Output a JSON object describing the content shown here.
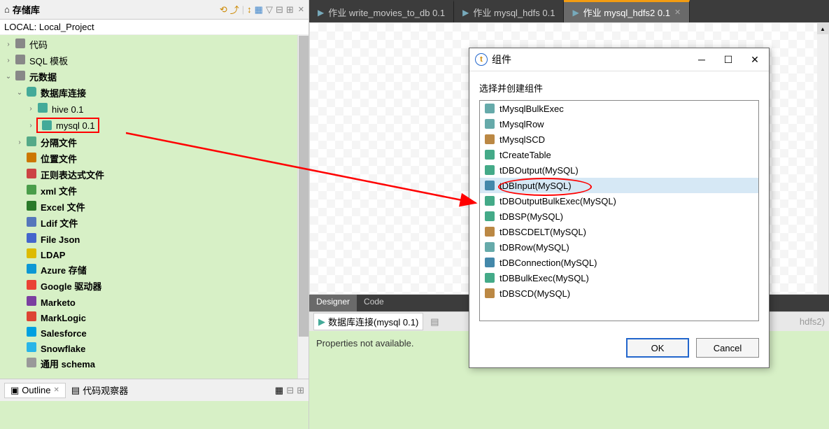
{
  "sidebar": {
    "title": "存储库",
    "local_label": "LOCAL: Local_Project",
    "items": [
      {
        "expand": "›",
        "icon": "ico-code",
        "label": "代码",
        "indent": 0
      },
      {
        "expand": "›",
        "icon": "ico-sql",
        "label": "SQL 模板",
        "indent": 0
      },
      {
        "expand": "⌄",
        "icon": "ico-folder",
        "label": "元数据",
        "indent": 0,
        "bold": true
      },
      {
        "expand": "⌄",
        "icon": "ico-db",
        "label": "数据库连接",
        "indent": 1,
        "bold": true,
        "green": true
      },
      {
        "expand": "›",
        "icon": "ico-arrow",
        "label": "hive 0.1",
        "indent": 2,
        "green": true
      },
      {
        "expand": "›",
        "icon": "ico-arrow",
        "label": "mysql 0.1",
        "indent": 2,
        "selected": true,
        "highlight": true,
        "green": true
      },
      {
        "expand": "›",
        "icon": "ico-delim",
        "label": "分隔文件",
        "indent": 1,
        "bold": true
      },
      {
        "expand": "",
        "icon": "ico-pos",
        "label": "位置文件",
        "indent": 1,
        "bold": true
      },
      {
        "expand": "",
        "icon": "ico-regex",
        "label": "正则表达式文件",
        "indent": 1,
        "bold": true
      },
      {
        "expand": "",
        "icon": "ico-xml",
        "label": "xml 文件",
        "indent": 1,
        "bold": true
      },
      {
        "expand": "",
        "icon": "ico-excel",
        "label": "Excel 文件",
        "indent": 1,
        "bold": true
      },
      {
        "expand": "",
        "icon": "ico-file",
        "label": "Ldif 文件",
        "indent": 1,
        "bold": true
      },
      {
        "expand": "",
        "icon": "ico-json",
        "label": "File Json",
        "indent": 1,
        "bold": true
      },
      {
        "expand": "",
        "icon": "ico-ldap",
        "label": "LDAP",
        "indent": 1,
        "bold": true
      },
      {
        "expand": "",
        "icon": "ico-azure",
        "label": "Azure 存储",
        "indent": 1,
        "bold": true
      },
      {
        "expand": "",
        "icon": "ico-google",
        "label": "Google 驱动器",
        "indent": 1,
        "bold": true
      },
      {
        "expand": "",
        "icon": "ico-marketo",
        "label": "Marketo",
        "indent": 1,
        "bold": true
      },
      {
        "expand": "",
        "icon": "ico-marklogic",
        "label": "MarkLogic",
        "indent": 1,
        "bold": true
      },
      {
        "expand": "",
        "icon": "ico-salesforce",
        "label": "Salesforce",
        "indent": 1,
        "bold": true
      },
      {
        "expand": "",
        "icon": "ico-snowflake",
        "label": "Snowflake",
        "indent": 1,
        "bold": true
      },
      {
        "expand": "",
        "icon": "ico-schema",
        "label": "通用 schema",
        "indent": 1,
        "bold": true
      }
    ]
  },
  "outline": {
    "tab1": "Outline",
    "tab2": "代码观察器"
  },
  "editor": {
    "tabs": [
      {
        "label": "作业 write_movies_to_db 0.1",
        "active": false
      },
      {
        "label": "作业 mysql_hdfs 0.1",
        "active": false
      },
      {
        "label": "作业 mysql_hdfs2 0.1",
        "active": true
      }
    ],
    "canvas_tabs": {
      "designer": "Designer",
      "code": "Code"
    },
    "bottom_tabs": {
      "db": "数据库连接(mysql 0.1)",
      "rest": "hdfs2)"
    },
    "properties_text": "Properties not available."
  },
  "dialog": {
    "title": "组件",
    "label": "选择并创建组件",
    "components": [
      "tMysqlBulkExec",
      "tMysqlRow",
      "tMysqlSCD",
      "tCreateTable",
      "tDBOutput(MySQL)",
      "tDBInput(MySQL)",
      "tDBOutputBulkExec(MySQL)",
      "tDBSP(MySQL)",
      "tDBSCDELT(MySQL)",
      "tDBRow(MySQL)",
      "tDBConnection(MySQL)",
      "tDBBulkExec(MySQL)",
      "tDBSCD(MySQL)"
    ],
    "selected_index": 5,
    "ok": "OK",
    "cancel": "Cancel"
  }
}
